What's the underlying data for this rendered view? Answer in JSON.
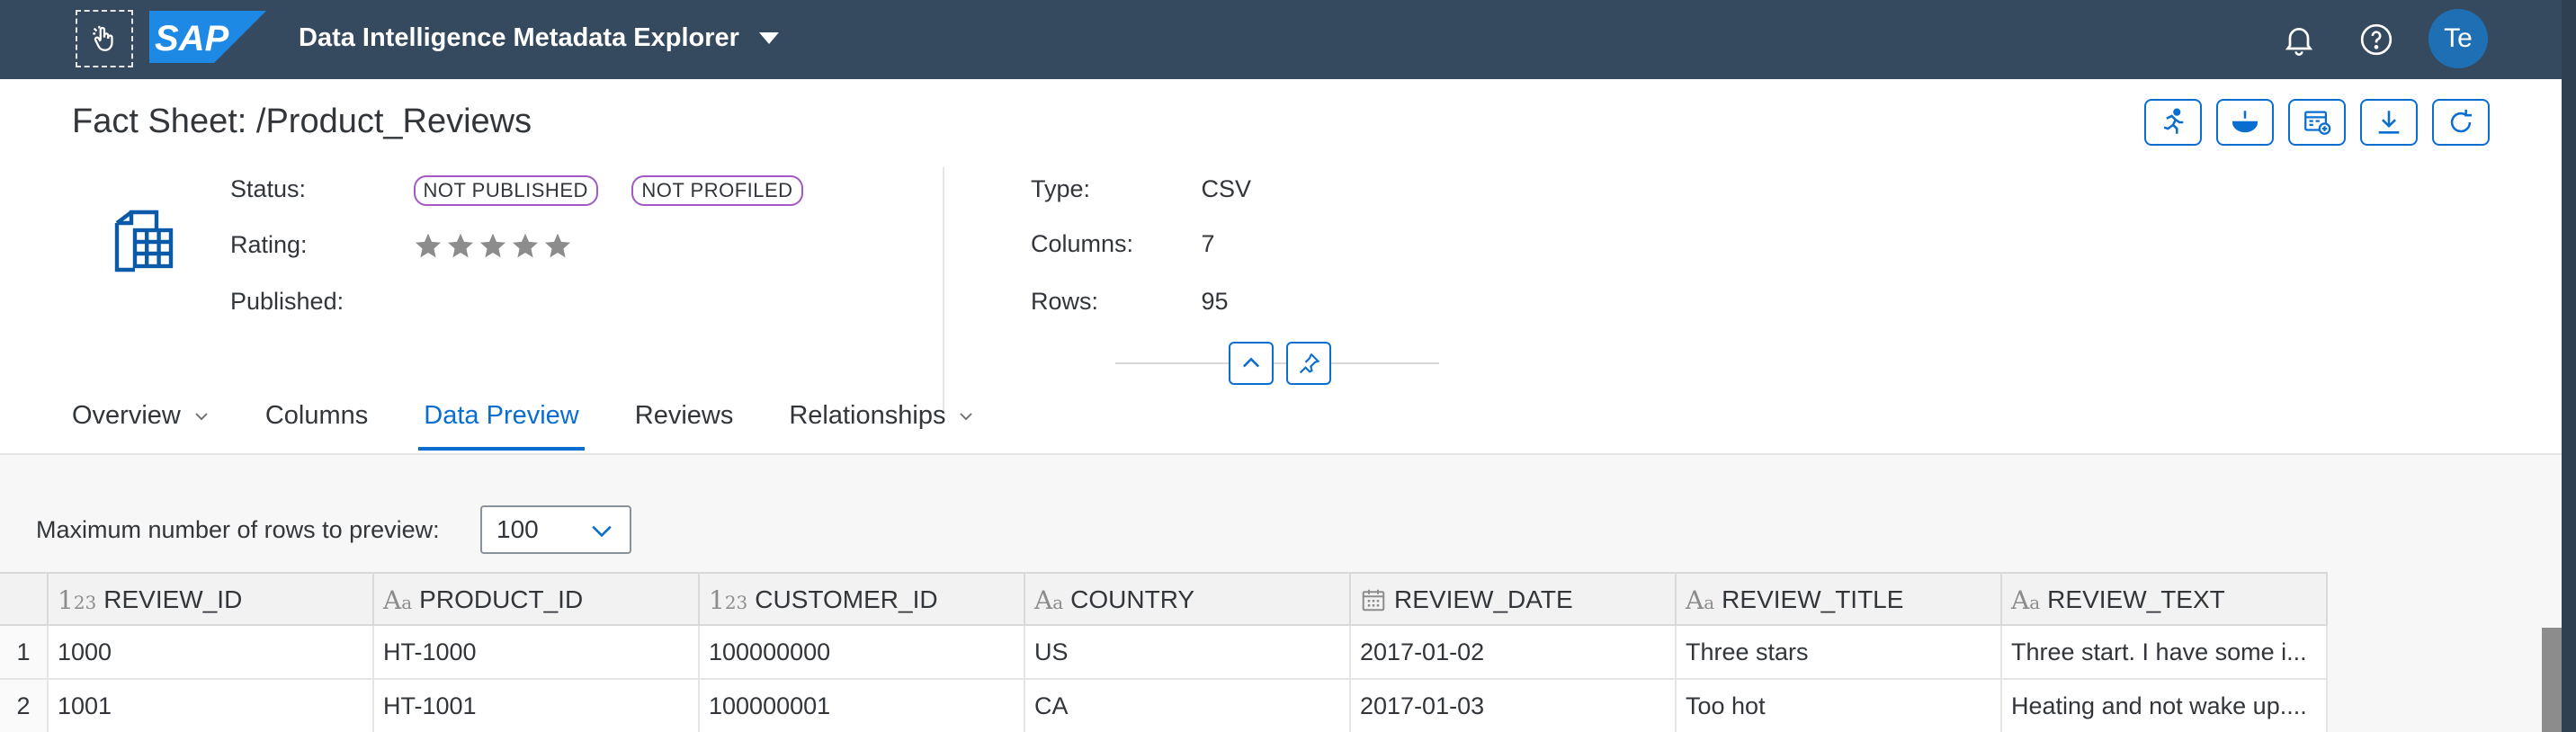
{
  "shell": {
    "logo_text": "SAP",
    "app_title": "Data Intelligence Metadata Explorer",
    "avatar_initials": "Te"
  },
  "header": {
    "title": "Fact Sheet: /Product_Reviews",
    "status_label": "Status:",
    "status_badges": [
      "NOT PUBLISHED",
      "NOT PROFILED"
    ],
    "rating_label": "Rating:",
    "rating_value": 0,
    "rating_max": 5,
    "published_label": "Published:",
    "type_label": "Type:",
    "type_value": "CSV",
    "columns_label": "Columns:",
    "columns_value": "7",
    "rows_label": "Rows:",
    "rows_value": "95"
  },
  "tabs": [
    {
      "label": "Overview",
      "has_menu": true
    },
    {
      "label": "Columns",
      "has_menu": false
    },
    {
      "label": "Data Preview",
      "has_menu": false,
      "active": true
    },
    {
      "label": "Reviews",
      "has_menu": false
    },
    {
      "label": "Relationships",
      "has_menu": true
    }
  ],
  "preview": {
    "max_rows_label": "Maximum number of rows to preview:",
    "max_rows_value": "100"
  },
  "table": {
    "columns": [
      {
        "name": "REVIEW_ID",
        "type_icon": "123"
      },
      {
        "name": "PRODUCT_ID",
        "type_icon": "Aa"
      },
      {
        "name": "CUSTOMER_ID",
        "type_icon": "123"
      },
      {
        "name": "COUNTRY",
        "type_icon": "Aa"
      },
      {
        "name": "REVIEW_DATE",
        "type_icon": "calendar"
      },
      {
        "name": "REVIEW_TITLE",
        "type_icon": "Aa"
      },
      {
        "name": "REVIEW_TEXT",
        "type_icon": "Aa"
      }
    ],
    "rows": [
      {
        "num": "1",
        "cells": [
          "1000",
          "HT-1000",
          "100000000",
          "US",
          "2017-01-02",
          "Three stars",
          "Three start. I have some i..."
        ]
      },
      {
        "num": "2",
        "cells": [
          "1001",
          "HT-1001",
          "100000001",
          "CA",
          "2017-01-03",
          "Too hot",
          "Heating and not wake up...."
        ]
      }
    ]
  },
  "colors": {
    "shell_bg": "#354a5f",
    "accent": "#0a6ed1",
    "badge_border": "#a259c4"
  }
}
